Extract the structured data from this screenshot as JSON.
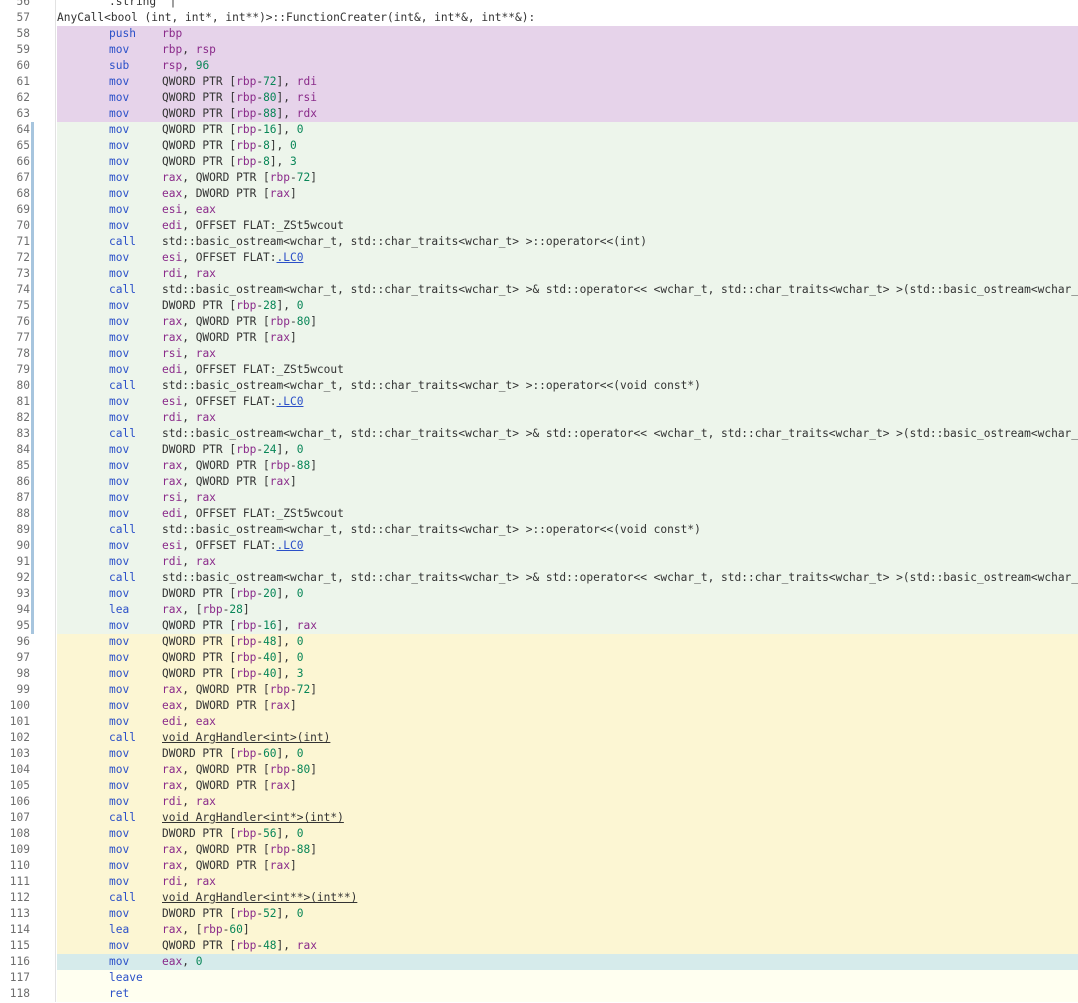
{
  "editor": {
    "lines": [
      {
        "num": "56",
        "bg": "none",
        "kind": "dir",
        "text": ".string \"|\""
      },
      {
        "num": "57",
        "bg": "none",
        "kind": "label",
        "text": "AnyCall<bool (int, int*, int**)>::FunctionCreater(int&, int*&, int**&):"
      },
      {
        "num": "58",
        "bg": "purple",
        "kind": "ins",
        "mnemonic": "push",
        "operands": "rbp"
      },
      {
        "num": "59",
        "bg": "purple",
        "kind": "ins",
        "mnemonic": "mov",
        "operands": "rbp, rsp"
      },
      {
        "num": "60",
        "bg": "purple",
        "kind": "ins",
        "mnemonic": "sub",
        "operands": "rsp, 96"
      },
      {
        "num": "61",
        "bg": "purple",
        "kind": "ins",
        "mnemonic": "mov",
        "operands": "QWORD PTR [rbp-72], rdi"
      },
      {
        "num": "62",
        "bg": "purple",
        "kind": "ins",
        "mnemonic": "mov",
        "operands": "QWORD PTR [rbp-80], rsi"
      },
      {
        "num": "63",
        "bg": "purple",
        "kind": "ins",
        "mnemonic": "mov",
        "operands": "QWORD PTR [rbp-88], rdx"
      },
      {
        "num": "64",
        "bg": "green",
        "marker": true,
        "kind": "ins",
        "mnemonic": "mov",
        "operands": "QWORD PTR [rbp-16], 0"
      },
      {
        "num": "65",
        "bg": "green",
        "marker": true,
        "kind": "ins",
        "mnemonic": "mov",
        "operands": "QWORD PTR [rbp-8], 0"
      },
      {
        "num": "66",
        "bg": "green",
        "marker": true,
        "kind": "ins",
        "mnemonic": "mov",
        "operands": "QWORD PTR [rbp-8], 3"
      },
      {
        "num": "67",
        "bg": "green",
        "marker": true,
        "kind": "ins",
        "mnemonic": "mov",
        "operands": "rax, QWORD PTR [rbp-72]"
      },
      {
        "num": "68",
        "bg": "green",
        "marker": true,
        "kind": "ins",
        "mnemonic": "mov",
        "operands": "eax, DWORD PTR [rax]"
      },
      {
        "num": "69",
        "bg": "green",
        "marker": true,
        "kind": "ins",
        "mnemonic": "mov",
        "operands": "esi, eax"
      },
      {
        "num": "70",
        "bg": "green",
        "marker": true,
        "kind": "ins",
        "mnemonic": "mov",
        "operands": "edi, OFFSET FLAT:_ZSt5wcout"
      },
      {
        "num": "71",
        "bg": "green",
        "marker": true,
        "kind": "ins",
        "mnemonic": "call",
        "operands": "std::basic_ostream<wchar_t, std::char_traits<wchar_t> >::operator<<(int)"
      },
      {
        "num": "72",
        "bg": "green",
        "marker": true,
        "kind": "ins",
        "mnemonic": "mov",
        "operands_pre": "esi, OFFSET FLAT:",
        "operands_link": ".LC0"
      },
      {
        "num": "73",
        "bg": "green",
        "marker": true,
        "kind": "ins",
        "mnemonic": "mov",
        "operands": "rdi, rax"
      },
      {
        "num": "74",
        "bg": "green",
        "marker": true,
        "kind": "ins",
        "mnemonic": "call",
        "operands": "std::basic_ostream<wchar_t, std::char_traits<wchar_t> >& std::operator<< <wchar_t, std::char_traits<wchar_t> >(std::basic_ostream<wchar_t,"
      },
      {
        "num": "75",
        "bg": "green",
        "marker": true,
        "kind": "ins",
        "mnemonic": "mov",
        "operands": "DWORD PTR [rbp-28], 0"
      },
      {
        "num": "76",
        "bg": "green",
        "marker": true,
        "kind": "ins",
        "mnemonic": "mov",
        "operands": "rax, QWORD PTR [rbp-80]"
      },
      {
        "num": "77",
        "bg": "green",
        "marker": true,
        "kind": "ins",
        "mnemonic": "mov",
        "operands": "rax, QWORD PTR [rax]"
      },
      {
        "num": "78",
        "bg": "green",
        "marker": true,
        "kind": "ins",
        "mnemonic": "mov",
        "operands": "rsi, rax"
      },
      {
        "num": "79",
        "bg": "green",
        "marker": true,
        "kind": "ins",
        "mnemonic": "mov",
        "operands": "edi, OFFSET FLAT:_ZSt5wcout"
      },
      {
        "num": "80",
        "bg": "green",
        "marker": true,
        "kind": "ins",
        "mnemonic": "call",
        "operands": "std::basic_ostream<wchar_t, std::char_traits<wchar_t> >::operator<<(void const*)"
      },
      {
        "num": "81",
        "bg": "green",
        "marker": true,
        "kind": "ins",
        "mnemonic": "mov",
        "operands_pre": "esi, OFFSET FLAT:",
        "operands_link": ".LC0"
      },
      {
        "num": "82",
        "bg": "green",
        "marker": true,
        "kind": "ins",
        "mnemonic": "mov",
        "operands": "rdi, rax"
      },
      {
        "num": "83",
        "bg": "green",
        "marker": true,
        "kind": "ins",
        "mnemonic": "call",
        "operands": "std::basic_ostream<wchar_t, std::char_traits<wchar_t> >& std::operator<< <wchar_t, std::char_traits<wchar_t> >(std::basic_ostream<wchar_t,"
      },
      {
        "num": "84",
        "bg": "green",
        "marker": true,
        "kind": "ins",
        "mnemonic": "mov",
        "operands": "DWORD PTR [rbp-24], 0"
      },
      {
        "num": "85",
        "bg": "green",
        "marker": true,
        "kind": "ins",
        "mnemonic": "mov",
        "operands": "rax, QWORD PTR [rbp-88]"
      },
      {
        "num": "86",
        "bg": "green",
        "marker": true,
        "kind": "ins",
        "mnemonic": "mov",
        "operands": "rax, QWORD PTR [rax]"
      },
      {
        "num": "87",
        "bg": "green",
        "marker": true,
        "kind": "ins",
        "mnemonic": "mov",
        "operands": "rsi, rax"
      },
      {
        "num": "88",
        "bg": "green",
        "marker": true,
        "kind": "ins",
        "mnemonic": "mov",
        "operands": "edi, OFFSET FLAT:_ZSt5wcout"
      },
      {
        "num": "89",
        "bg": "green",
        "marker": true,
        "kind": "ins",
        "mnemonic": "call",
        "operands": "std::basic_ostream<wchar_t, std::char_traits<wchar_t> >::operator<<(void const*)"
      },
      {
        "num": "90",
        "bg": "green",
        "marker": true,
        "kind": "ins",
        "mnemonic": "mov",
        "operands_pre": "esi, OFFSET FLAT:",
        "operands_link": ".LC0"
      },
      {
        "num": "91",
        "bg": "green",
        "marker": true,
        "kind": "ins",
        "mnemonic": "mov",
        "operands": "rdi, rax"
      },
      {
        "num": "92",
        "bg": "green",
        "marker": true,
        "kind": "ins",
        "mnemonic": "call",
        "operands": "std::basic_ostream<wchar_t, std::char_traits<wchar_t> >& std::operator<< <wchar_t, std::char_traits<wchar_t> >(std::basic_ostream<wchar_t,"
      },
      {
        "num": "93",
        "bg": "green",
        "marker": true,
        "kind": "ins",
        "mnemonic": "mov",
        "operands": "DWORD PTR [rbp-20], 0"
      },
      {
        "num": "94",
        "bg": "green",
        "marker": true,
        "kind": "ins",
        "mnemonic": "lea",
        "operands": "rax, [rbp-28]"
      },
      {
        "num": "95",
        "bg": "green",
        "marker": true,
        "kind": "ins",
        "mnemonic": "mov",
        "operands": "QWORD PTR [rbp-16], rax"
      },
      {
        "num": "96",
        "bg": "yellow",
        "kind": "ins",
        "mnemonic": "mov",
        "operands": "QWORD PTR [rbp-48], 0"
      },
      {
        "num": "97",
        "bg": "yellow",
        "kind": "ins",
        "mnemonic": "mov",
        "operands": "QWORD PTR [rbp-40], 0"
      },
      {
        "num": "98",
        "bg": "yellow",
        "kind": "ins",
        "mnemonic": "mov",
        "operands": "QWORD PTR [rbp-40], 3"
      },
      {
        "num": "99",
        "bg": "yellow",
        "kind": "ins",
        "mnemonic": "mov",
        "operands": "rax, QWORD PTR [rbp-72]"
      },
      {
        "num": "100",
        "bg": "yellow",
        "kind": "ins",
        "mnemonic": "mov",
        "operands": "eax, DWORD PTR [rax]"
      },
      {
        "num": "101",
        "bg": "yellow",
        "kind": "ins",
        "mnemonic": "mov",
        "operands": "edi, eax"
      },
      {
        "num": "102",
        "bg": "yellow",
        "kind": "ins",
        "mnemonic": "call",
        "operands_call_link": "void ArgHandler<int>(int)"
      },
      {
        "num": "103",
        "bg": "yellow",
        "kind": "ins",
        "mnemonic": "mov",
        "operands": "DWORD PTR [rbp-60], 0"
      },
      {
        "num": "104",
        "bg": "yellow",
        "kind": "ins",
        "mnemonic": "mov",
        "operands": "rax, QWORD PTR [rbp-80]"
      },
      {
        "num": "105",
        "bg": "yellow",
        "kind": "ins",
        "mnemonic": "mov",
        "operands": "rax, QWORD PTR [rax]"
      },
      {
        "num": "106",
        "bg": "yellow",
        "kind": "ins",
        "mnemonic": "mov",
        "operands": "rdi, rax"
      },
      {
        "num": "107",
        "bg": "yellow",
        "kind": "ins",
        "mnemonic": "call",
        "operands_call_link": "void ArgHandler<int*>(int*)"
      },
      {
        "num": "108",
        "bg": "yellow",
        "kind": "ins",
        "mnemonic": "mov",
        "operands": "DWORD PTR [rbp-56], 0"
      },
      {
        "num": "109",
        "bg": "yellow",
        "kind": "ins",
        "mnemonic": "mov",
        "operands": "rax, QWORD PTR [rbp-88]"
      },
      {
        "num": "110",
        "bg": "yellow",
        "kind": "ins",
        "mnemonic": "mov",
        "operands": "rax, QWORD PTR [rax]"
      },
      {
        "num": "111",
        "bg": "yellow",
        "kind": "ins",
        "mnemonic": "mov",
        "operands": "rdi, rax"
      },
      {
        "num": "112",
        "bg": "yellow",
        "kind": "ins",
        "mnemonic": "call",
        "operands_call_link": "void ArgHandler<int**>(int**)"
      },
      {
        "num": "113",
        "bg": "yellow",
        "kind": "ins",
        "mnemonic": "mov",
        "operands": "DWORD PTR [rbp-52], 0"
      },
      {
        "num": "114",
        "bg": "yellow",
        "kind": "ins",
        "mnemonic": "lea",
        "operands": "rax, [rbp-60]"
      },
      {
        "num": "115",
        "bg": "yellow",
        "kind": "ins",
        "mnemonic": "mov",
        "operands": "QWORD PTR [rbp-48], rax"
      },
      {
        "num": "116",
        "bg": "cyan",
        "kind": "ins",
        "mnemonic": "mov",
        "operands": "eax, 0"
      },
      {
        "num": "117",
        "bg": "cream",
        "kind": "ins",
        "mnemonic": "leave",
        "operands": ""
      },
      {
        "num": "118",
        "bg": "cream",
        "kind": "ins",
        "mnemonic": "ret",
        "operands": ""
      }
    ]
  },
  "colors": {
    "purple": "#e6d3ea",
    "green": "#edf5eb",
    "yellow": "#fcf6d3",
    "cyan": "#d6ebeb",
    "cream": "#fffff0",
    "mnemonic": "#2b50c8",
    "register": "#8a2a8a",
    "number": "#098658"
  }
}
